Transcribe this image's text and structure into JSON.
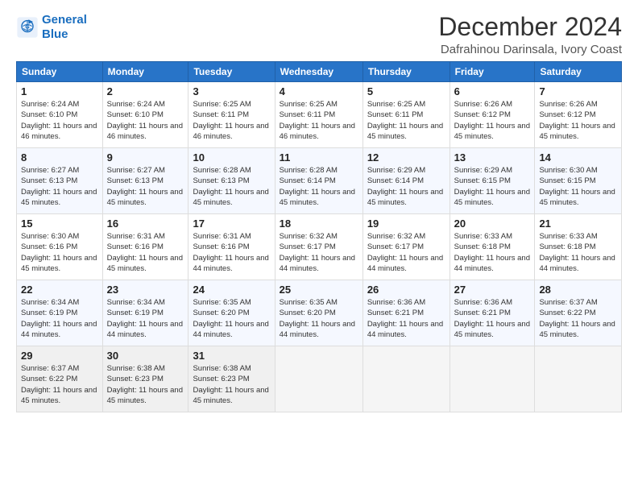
{
  "logo": {
    "line1": "General",
    "line2": "Blue"
  },
  "title": "December 2024",
  "location": "Dafrahinou Darinsala, Ivory Coast",
  "days_of_week": [
    "Sunday",
    "Monday",
    "Tuesday",
    "Wednesday",
    "Thursday",
    "Friday",
    "Saturday"
  ],
  "weeks": [
    [
      {
        "day": "1",
        "sunrise": "6:24 AM",
        "sunset": "6:10 PM",
        "daylight": "11 hours and 46 minutes."
      },
      {
        "day": "2",
        "sunrise": "6:24 AM",
        "sunset": "6:10 PM",
        "daylight": "11 hours and 46 minutes."
      },
      {
        "day": "3",
        "sunrise": "6:25 AM",
        "sunset": "6:11 PM",
        "daylight": "11 hours and 46 minutes."
      },
      {
        "day": "4",
        "sunrise": "6:25 AM",
        "sunset": "6:11 PM",
        "daylight": "11 hours and 46 minutes."
      },
      {
        "day": "5",
        "sunrise": "6:25 AM",
        "sunset": "6:11 PM",
        "daylight": "11 hours and 45 minutes."
      },
      {
        "day": "6",
        "sunrise": "6:26 AM",
        "sunset": "6:12 PM",
        "daylight": "11 hours and 45 minutes."
      },
      {
        "day": "7",
        "sunrise": "6:26 AM",
        "sunset": "6:12 PM",
        "daylight": "11 hours and 45 minutes."
      }
    ],
    [
      {
        "day": "8",
        "sunrise": "6:27 AM",
        "sunset": "6:13 PM",
        "daylight": "11 hours and 45 minutes."
      },
      {
        "day": "9",
        "sunrise": "6:27 AM",
        "sunset": "6:13 PM",
        "daylight": "11 hours and 45 minutes."
      },
      {
        "day": "10",
        "sunrise": "6:28 AM",
        "sunset": "6:13 PM",
        "daylight": "11 hours and 45 minutes."
      },
      {
        "day": "11",
        "sunrise": "6:28 AM",
        "sunset": "6:14 PM",
        "daylight": "11 hours and 45 minutes."
      },
      {
        "day": "12",
        "sunrise": "6:29 AM",
        "sunset": "6:14 PM",
        "daylight": "11 hours and 45 minutes."
      },
      {
        "day": "13",
        "sunrise": "6:29 AM",
        "sunset": "6:15 PM",
        "daylight": "11 hours and 45 minutes."
      },
      {
        "day": "14",
        "sunrise": "6:30 AM",
        "sunset": "6:15 PM",
        "daylight": "11 hours and 45 minutes."
      }
    ],
    [
      {
        "day": "15",
        "sunrise": "6:30 AM",
        "sunset": "6:16 PM",
        "daylight": "11 hours and 45 minutes."
      },
      {
        "day": "16",
        "sunrise": "6:31 AM",
        "sunset": "6:16 PM",
        "daylight": "11 hours and 45 minutes."
      },
      {
        "day": "17",
        "sunrise": "6:31 AM",
        "sunset": "6:16 PM",
        "daylight": "11 hours and 44 minutes."
      },
      {
        "day": "18",
        "sunrise": "6:32 AM",
        "sunset": "6:17 PM",
        "daylight": "11 hours and 44 minutes."
      },
      {
        "day": "19",
        "sunrise": "6:32 AM",
        "sunset": "6:17 PM",
        "daylight": "11 hours and 44 minutes."
      },
      {
        "day": "20",
        "sunrise": "6:33 AM",
        "sunset": "6:18 PM",
        "daylight": "11 hours and 44 minutes."
      },
      {
        "day": "21",
        "sunrise": "6:33 AM",
        "sunset": "6:18 PM",
        "daylight": "11 hours and 44 minutes."
      }
    ],
    [
      {
        "day": "22",
        "sunrise": "6:34 AM",
        "sunset": "6:19 PM",
        "daylight": "11 hours and 44 minutes."
      },
      {
        "day": "23",
        "sunrise": "6:34 AM",
        "sunset": "6:19 PM",
        "daylight": "11 hours and 44 minutes."
      },
      {
        "day": "24",
        "sunrise": "6:35 AM",
        "sunset": "6:20 PM",
        "daylight": "11 hours and 44 minutes."
      },
      {
        "day": "25",
        "sunrise": "6:35 AM",
        "sunset": "6:20 PM",
        "daylight": "11 hours and 44 minutes."
      },
      {
        "day": "26",
        "sunrise": "6:36 AM",
        "sunset": "6:21 PM",
        "daylight": "11 hours and 44 minutes."
      },
      {
        "day": "27",
        "sunrise": "6:36 AM",
        "sunset": "6:21 PM",
        "daylight": "11 hours and 45 minutes."
      },
      {
        "day": "28",
        "sunrise": "6:37 AM",
        "sunset": "6:22 PM",
        "daylight": "11 hours and 45 minutes."
      }
    ],
    [
      {
        "day": "29",
        "sunrise": "6:37 AM",
        "sunset": "6:22 PM",
        "daylight": "11 hours and 45 minutes."
      },
      {
        "day": "30",
        "sunrise": "6:38 AM",
        "sunset": "6:23 PM",
        "daylight": "11 hours and 45 minutes."
      },
      {
        "day": "31",
        "sunrise": "6:38 AM",
        "sunset": "6:23 PM",
        "daylight": "11 hours and 45 minutes."
      },
      null,
      null,
      null,
      null
    ]
  ]
}
